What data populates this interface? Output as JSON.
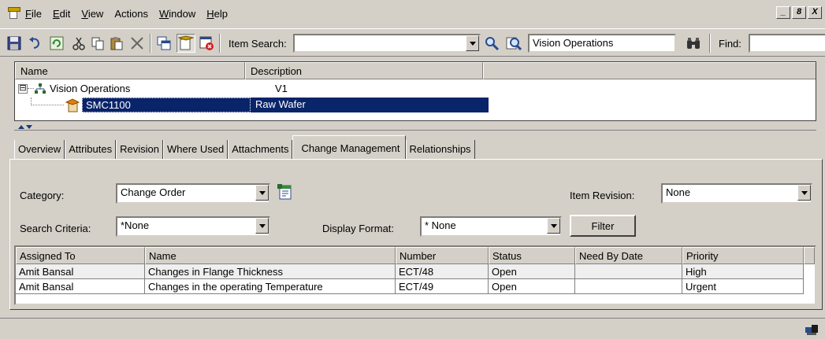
{
  "menu": {
    "file": "File",
    "edit": "Edit",
    "view": "View",
    "actions": "Actions",
    "window": "Window",
    "help": "Help"
  },
  "window_controls": {
    "minimize": "_",
    "restore": "8",
    "close": "X"
  },
  "toolbar": {
    "item_search_label": "Item Search:",
    "item_search_value": "",
    "org_value": "Vision Operations",
    "find_label": "Find:",
    "find_value": ""
  },
  "tree": {
    "columns": [
      "Name",
      "Description"
    ],
    "rows": [
      {
        "name": "Vision Operations",
        "description": "V1",
        "expander": "⊟"
      },
      {
        "name": "SMC1100",
        "description": "Raw Wafer"
      }
    ]
  },
  "tabs": [
    "Overview",
    "Attributes",
    "Revision",
    "Where Used",
    "Attachments",
    "Change Management",
    "Relationships"
  ],
  "active_tab": "Change Management",
  "form": {
    "category_label": "Category:",
    "category_value": "Change Order",
    "item_revision_label": "Item Revision:",
    "item_revision_value": "None",
    "search_criteria_label": "Search Criteria:",
    "search_criteria_value": "*None",
    "display_format_label": "Display Format:",
    "display_format_value": "* None",
    "filter_button": "Filter"
  },
  "grid": {
    "columns": [
      "Assigned To",
      "Name",
      "Number",
      "Status",
      "Need By Date",
      "Priority"
    ],
    "rows": [
      [
        "Amit Bansal",
        "Changes in Flange Thickness",
        "ECT/48",
        "Open",
        "",
        "High"
      ],
      [
        "Amit Bansal",
        "Changes in the operating Temperature",
        "ECT/49",
        "Open",
        "",
        "Urgent"
      ]
    ]
  },
  "colors": {
    "chrome": "#d4d0c8",
    "selection": "#0a246a",
    "selection_text": "#ffffff"
  }
}
